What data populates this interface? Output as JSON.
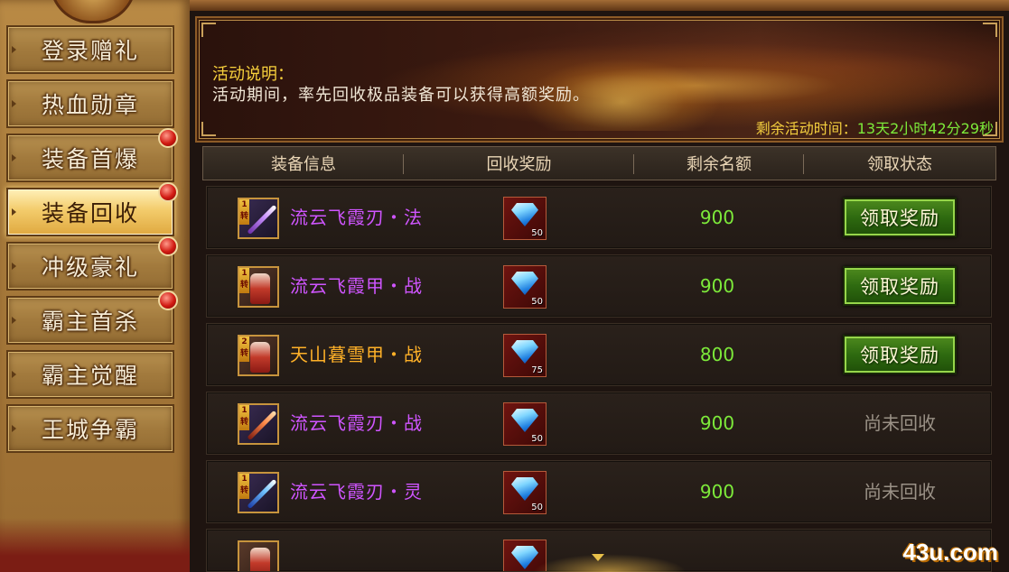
{
  "sidebar": {
    "items": [
      {
        "label": "登录赠礼",
        "badge": false,
        "active": false
      },
      {
        "label": "热血勋章",
        "badge": false,
        "active": false
      },
      {
        "label": "装备首爆",
        "badge": true,
        "active": false
      },
      {
        "label": "装备回收",
        "badge": true,
        "active": true
      },
      {
        "label": "冲级豪礼",
        "badge": true,
        "active": false
      },
      {
        "label": "霸主首杀",
        "badge": true,
        "active": false
      },
      {
        "label": "霸主觉醒",
        "badge": false,
        "active": false
      },
      {
        "label": "王城争霸",
        "badge": false,
        "active": false
      }
    ]
  },
  "banner": {
    "title": "活动说明：",
    "description": "活动期间，率先回收极品装备可以获得高额奖励。",
    "timer_label": "剩余活动时间：",
    "timer_value": "13天2小时42分29秒"
  },
  "table": {
    "headers": [
      "装备信息",
      "回收奖励",
      "剩余名额",
      "领取状态"
    ],
    "rows": [
      {
        "rank": "1转",
        "name": "流云飞霞刃・法",
        "name_color": "purple",
        "icon": "purple-sword-icon",
        "reward_qty": "50",
        "remaining": "900",
        "status": "领取奖励",
        "claimable": true
      },
      {
        "rank": "1转",
        "name": "流云飞霞甲・战",
        "name_color": "purple",
        "icon": "armor-icon",
        "reward_qty": "50",
        "remaining": "900",
        "status": "领取奖励",
        "claimable": true
      },
      {
        "rank": "2转",
        "name": "天山暮雪甲・战",
        "name_color": "orange",
        "icon": "armor-icon",
        "reward_qty": "75",
        "remaining": "800",
        "status": "领取奖励",
        "claimable": true
      },
      {
        "rank": "1转",
        "name": "流云飞霞刃・战",
        "name_color": "purple",
        "icon": "red-sword-icon",
        "reward_qty": "50",
        "remaining": "900",
        "status": "尚未回收",
        "claimable": false
      },
      {
        "rank": "1转",
        "name": "流云飞霞刃・灵",
        "name_color": "purple",
        "icon": "blue-sword-icon",
        "reward_qty": "50",
        "remaining": "900",
        "status": "尚未回收",
        "claimable": false
      }
    ]
  },
  "watermark": "43u.com",
  "colors": {
    "accent_green": "#7dea3a",
    "gold": "#f4cf3e",
    "purple_item": "#cf55ff",
    "orange_item": "#ffb128",
    "muted_status": "#9a9186"
  }
}
